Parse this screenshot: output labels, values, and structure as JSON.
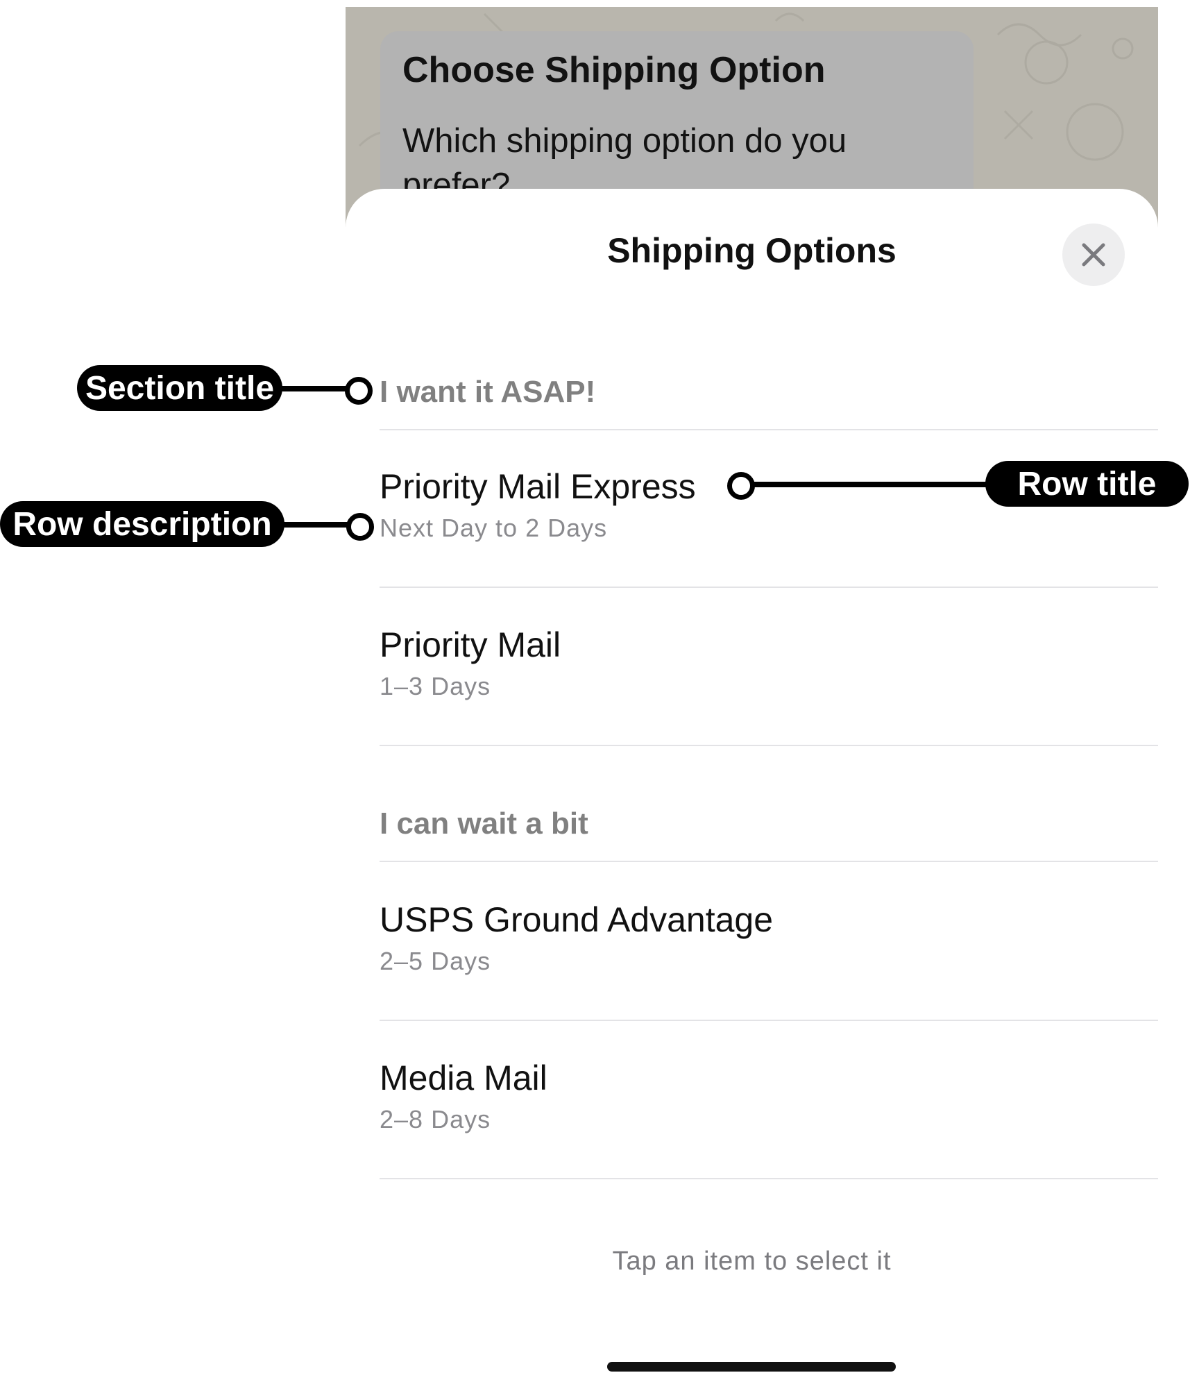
{
  "chat": {
    "message_title": "Choose Shipping Option",
    "message_text": "Which shipping option do you prefer?"
  },
  "sheet": {
    "title": "Shipping Options",
    "close_icon": "close-icon",
    "sections": [
      {
        "title": "I want it ASAP!",
        "rows": [
          {
            "title": "Priority Mail Express",
            "description": "Next Day to 2 Days"
          },
          {
            "title": "Priority Mail",
            "description": "1–3 Days"
          }
        ]
      },
      {
        "title": "I can wait a bit",
        "rows": [
          {
            "title": "USPS Ground Advantage",
            "description": "2–5 Days"
          },
          {
            "title": "Media Mail",
            "description": "2–8 Days"
          }
        ]
      }
    ],
    "footer_hint": "Tap an item to select it"
  },
  "callouts": {
    "section_title": "Section title",
    "row_title": "Row title",
    "row_description": "Row description"
  }
}
